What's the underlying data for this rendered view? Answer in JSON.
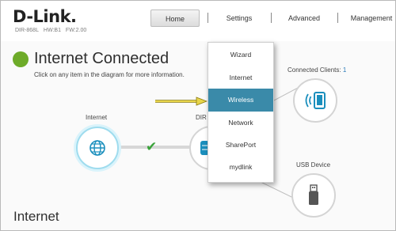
{
  "brand": {
    "logo": "D-Link",
    "model": "DIR-868L",
    "hw": "HW:B1",
    "fw": "FW:2.00"
  },
  "nav": {
    "home": "Home",
    "settings": "Settings",
    "advanced": "Advanced",
    "management": "Management",
    "active": "Home"
  },
  "status": {
    "title": "Internet Connected",
    "instruction": "Click on any item in the diagram for more information.",
    "color": "#6eab29"
  },
  "diagram": {
    "internet_label": "Internet",
    "router_label_partial": "DIR",
    "clients_label": "Connected Clients:",
    "clients_count": "1",
    "usb_label": "USB Device",
    "link_status": "check"
  },
  "settings_menu": {
    "items": [
      "Wizard",
      "Internet",
      "Wireless",
      "Network",
      "SharePort",
      "mydlink"
    ],
    "selected": "Wireless"
  },
  "section": {
    "title": "Internet"
  },
  "colors": {
    "accent": "#3a8aa9",
    "highlight_ring": "#9fdcee",
    "arrow": "#e8d54a"
  }
}
